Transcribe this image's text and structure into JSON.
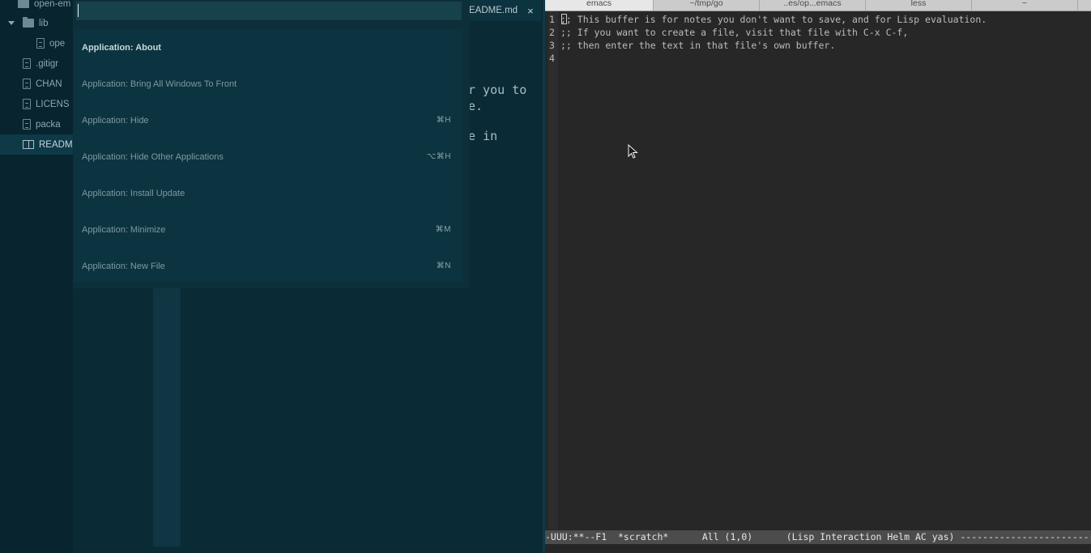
{
  "atom": {
    "tree": {
      "items": [
        {
          "label": "open-em",
          "kind": "folder-root"
        },
        {
          "label": "lib",
          "kind": "folder"
        },
        {
          "label": "ope",
          "kind": "file"
        },
        {
          "label": ".gitigr",
          "kind": "file"
        },
        {
          "label": "CHAN",
          "kind": "file"
        },
        {
          "label": "LICENS",
          "kind": "file"
        },
        {
          "label": "packa",
          "kind": "file"
        },
        {
          "label": "READM",
          "kind": "book"
        }
      ]
    },
    "tab": {
      "label": "EADME.md",
      "close": "×"
    },
    "editor_fragments": {
      "line1": "r you to",
      "line2": "e.",
      "line3": "e in"
    },
    "palette": {
      "query": "",
      "commands": [
        {
          "label": "Application: About",
          "shortcut": ""
        },
        {
          "label": "Application: Bring All Windows To Front",
          "shortcut": ""
        },
        {
          "label": "Application: Hide",
          "shortcut": "⌘H"
        },
        {
          "label": "Application: Hide Other Applications",
          "shortcut": "⌥⌘H"
        },
        {
          "label": "Application: Install Update",
          "shortcut": ""
        },
        {
          "label": "Application: Minimize",
          "shortcut": "⌘M"
        },
        {
          "label": "Application: New File",
          "shortcut": "⌘N"
        }
      ]
    }
  },
  "emacs": {
    "tabs": [
      "emacs",
      "~/tmp/go",
      "..es/op...emacs",
      "less",
      "~"
    ],
    "line_numbers": [
      "1",
      "2",
      "3",
      "4"
    ],
    "lines": [
      ";; This buffer is for notes you don't want to save, and for Lisp evaluation.",
      ";; If you want to create a file, visit that file with C-x C-f,",
      ";; then enter the text in that file's own buffer.",
      ""
    ],
    "mode_line": "-UUU:**--F1  *scratch*      All (1,0)      (Lisp Interaction Helm AC yas) -----------------------------------"
  }
}
